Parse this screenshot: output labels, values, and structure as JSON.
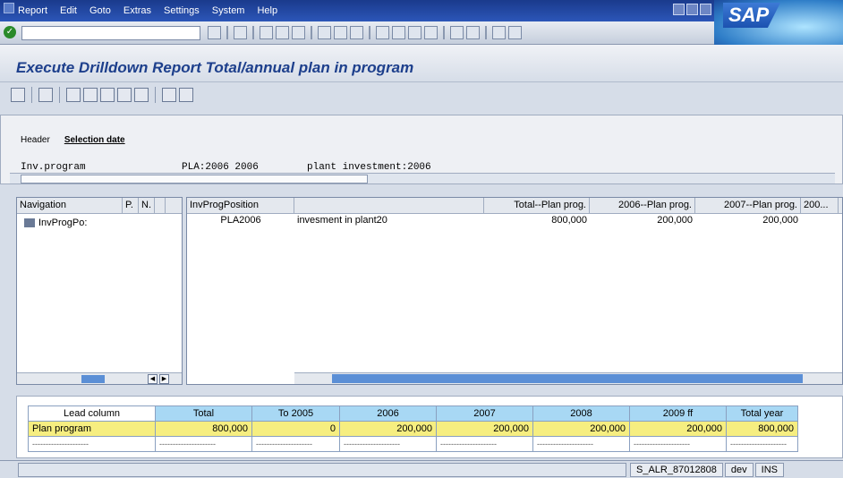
{
  "menu": {
    "items": [
      "Report",
      "Edit",
      "Goto",
      "Extras",
      "Settings",
      "System",
      "Help"
    ]
  },
  "title": "Execute Drilldown Report Total/annual plan in program",
  "header": {
    "tab1": "Header",
    "tab2": "Selection date",
    "row": {
      "k1": "Inv.program",
      "v1": "PLA:2006 2006",
      "v2": "plant investment:2006"
    }
  },
  "nav": {
    "col1": "Navigation",
    "col2": "P.",
    "col3": "N.",
    "item": "InvProgPo:"
  },
  "grid": {
    "cols": [
      "InvProgPosition",
      "",
      "Total--Plan prog.",
      "2006--Plan prog.",
      "2007--Plan prog.",
      "200..."
    ],
    "row": [
      "PLA2006",
      "invesment in plant20",
      "800,000",
      "200,000",
      "200,000",
      ""
    ]
  },
  "lower": {
    "cols": [
      "Lead column",
      "Total",
      "To 2005",
      "2006",
      "2007",
      "2008",
      "2009 ff",
      "Total year"
    ],
    "row": [
      "Plan program",
      "800,000",
      "0",
      "200,000",
      "200,000",
      "200,000",
      "200,000",
      "800,000"
    ],
    "dash": "---------------------"
  },
  "status": {
    "tcode": "S_ALR_87012808",
    "client": "dev",
    "mode": "INS"
  }
}
